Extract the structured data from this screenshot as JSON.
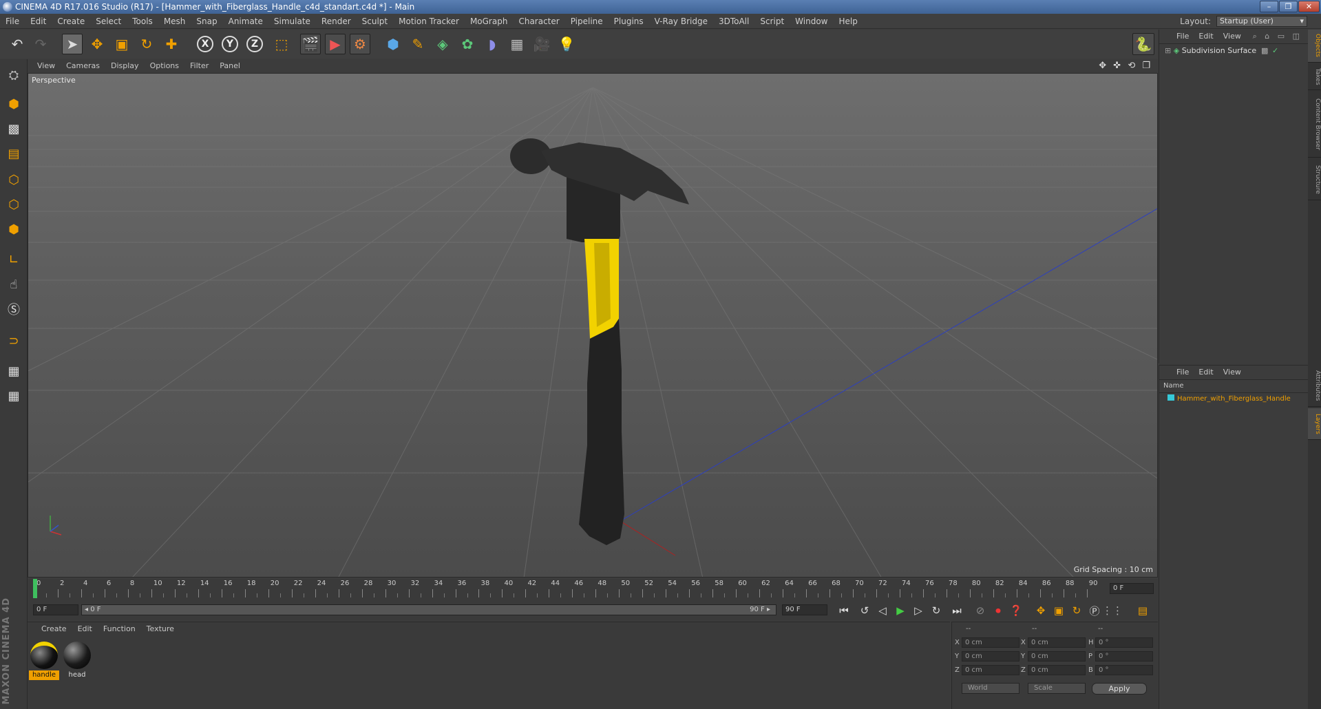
{
  "window": {
    "title": "CINEMA 4D R17.016 Studio (R17) - [Hammer_with_Fiberglass_Handle_c4d_standart.c4d *] - Main",
    "controls": [
      "–",
      "❐",
      "✕"
    ]
  },
  "menubar": {
    "items": [
      "File",
      "Edit",
      "Create",
      "Select",
      "Tools",
      "Mesh",
      "Snap",
      "Animate",
      "Simulate",
      "Render",
      "Sculpt",
      "Motion Tracker",
      "MoGraph",
      "Character",
      "Pipeline",
      "Plugins",
      "V-Ray Bridge",
      "3DToAll",
      "Script",
      "Window",
      "Help"
    ],
    "layout_label": "Layout:",
    "layout_value": "Startup (User)"
  },
  "toolbar": {
    "axis_x": "X",
    "axis_y": "Y",
    "axis_z": "Z"
  },
  "viewport": {
    "menu": [
      "View",
      "Cameras",
      "Display",
      "Options",
      "Filter",
      "Panel"
    ],
    "label": "Perspective",
    "grid_spacing": "Grid Spacing : 10 cm",
    "nav_icons": "✥ ✜ ⟲ ❐"
  },
  "timeline": {
    "ticks": [
      "0",
      "2",
      "4",
      "6",
      "8",
      "10",
      "12",
      "14",
      "16",
      "18",
      "20",
      "22",
      "24",
      "26",
      "28",
      "30",
      "32",
      "34",
      "36",
      "38",
      "40",
      "42",
      "44",
      "46",
      "48",
      "50",
      "52",
      "54",
      "56",
      "58",
      "60",
      "62",
      "64",
      "66",
      "68",
      "70",
      "72",
      "74",
      "76",
      "78",
      "80",
      "82",
      "84",
      "86",
      "88",
      "90"
    ],
    "current_frame": "0 F",
    "start_field": "0 F",
    "range_start": "◂ 0 F",
    "range_end": "90 F ▸",
    "end_field": "90 F"
  },
  "materials": {
    "menu": [
      "Create",
      "Edit",
      "Function",
      "Texture"
    ],
    "items": [
      {
        "name": "handle",
        "selected": true
      },
      {
        "name": "head",
        "selected": false
      }
    ]
  },
  "coordinates": {
    "headers": [
      "--",
      "--",
      "--"
    ],
    "rows": [
      {
        "a": "X",
        "av": "0 cm",
        "b": "X",
        "bv": "0 cm",
        "c": "H",
        "cv": "0 °"
      },
      {
        "a": "Y",
        "av": "0 cm",
        "b": "Y",
        "bv": "0 cm",
        "c": "P",
        "cv": "0 °"
      },
      {
        "a": "Z",
        "av": "0 cm",
        "b": "Z",
        "bv": "0 cm",
        "c": "B",
        "cv": "0 °"
      }
    ],
    "mode": "World",
    "transform": "Scale",
    "apply": "Apply"
  },
  "objects_panel": {
    "menu": [
      "File",
      "Edit",
      "View"
    ],
    "object": "Subdivision Surface"
  },
  "layers_panel": {
    "menu": [
      "File",
      "Edit",
      "View"
    ],
    "column": "Name",
    "item": "Hammer_with_Fiberglass_Handle"
  },
  "right_tabs": [
    "Objects",
    "Takes",
    "Content Browser",
    "Structure",
    "Attributes",
    "Layers"
  ],
  "brand": "MAXON CINEMA 4D",
  "colors": {
    "accent": "#f0a000",
    "handle_yellow": "#f2d200",
    "layer_color": "#36c9d8"
  }
}
